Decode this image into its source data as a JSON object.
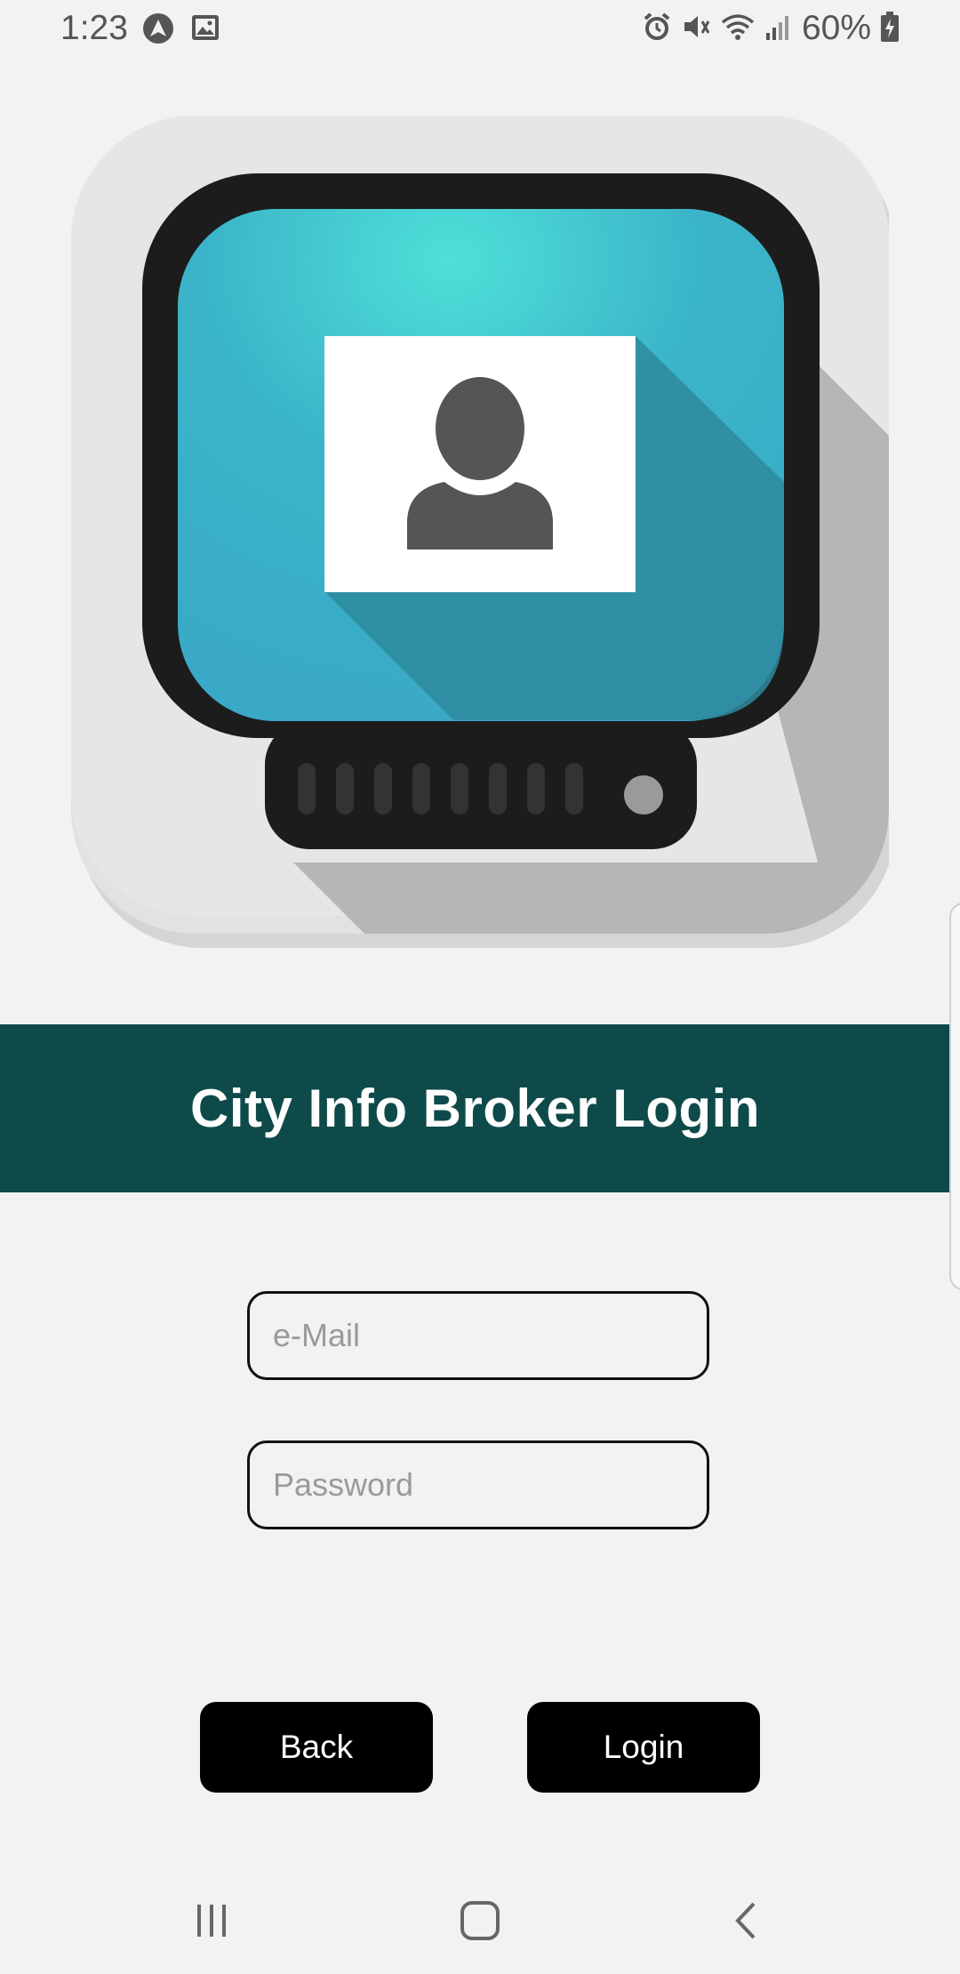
{
  "status_bar": {
    "time": "1:23",
    "battery": "60%",
    "left_icons": [
      "navigation-arrow-icon",
      "image-icon"
    ],
    "right_icons": [
      "alarm-icon",
      "mute-icon",
      "wifi-icon",
      "signal-icon",
      "battery-charging-icon"
    ]
  },
  "logo": {
    "icon": "monitor-user-icon"
  },
  "header": {
    "title": "City Info Broker Login"
  },
  "form": {
    "email_placeholder": "e-Mail",
    "email_value": "",
    "password_placeholder": "Password",
    "password_value": ""
  },
  "buttons": {
    "back_label": "Back",
    "login_label": "Login"
  },
  "nav_bar": {
    "icons": [
      "recents-icon",
      "home-icon",
      "back-icon"
    ]
  },
  "colors": {
    "banner": "#0e4a4a",
    "background": "#f2f2f2",
    "button": "#000000",
    "screen": "#3fb7c9"
  }
}
